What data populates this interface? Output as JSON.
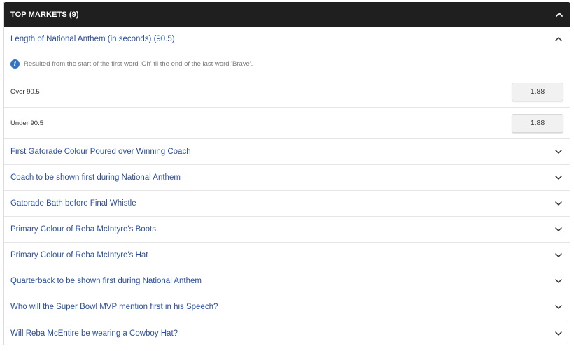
{
  "header": {
    "title": "TOP MARKETS (9)",
    "toggle_icon": "chevron-up-icon"
  },
  "open_market": {
    "title": "Length of National Anthem (in seconds) (90.5)",
    "toggle_icon": "chevron-up-icon",
    "info_icon": "info-icon",
    "info_text": "Resulted from the start of the first word 'Oh' til the end of the last word 'Brave'.",
    "selections": [
      {
        "label": "Over 90.5",
        "odds": "1.88"
      },
      {
        "label": "Under 90.5",
        "odds": "1.88"
      }
    ]
  },
  "markets": [
    {
      "title": "First Gatorade Colour Poured over Winning Coach"
    },
    {
      "title": "Coach to be shown first during National Anthem"
    },
    {
      "title": "Gatorade Bath before Final Whistle"
    },
    {
      "title": "Primary Colour of Reba McIntyre's Boots"
    },
    {
      "title": "Primary Colour of Reba McIntyre's Hat"
    },
    {
      "title": "Quarterback to be shown first during National Anthem"
    },
    {
      "title": "Who will the Super Bowl MVP mention first in his Speech?"
    },
    {
      "title": "Will Reba McEntire be wearing a Cowboy Hat?"
    }
  ],
  "colors": {
    "header_bg": "#1f1f1f",
    "link": "#2b4fa0",
    "info_icon": "#2f74c8"
  }
}
